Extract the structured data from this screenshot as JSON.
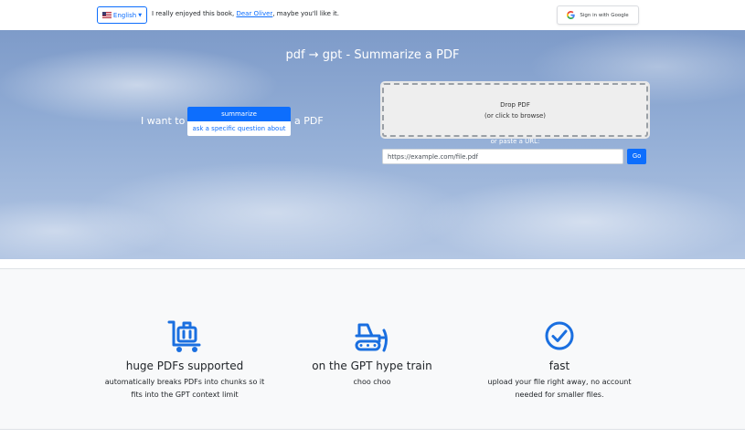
{
  "topbar": {
    "language": "English",
    "tagline_before": "I really enjoyed this book, ",
    "tagline_link": "Dear Oliver",
    "tagline_after": ", maybe you'll like it.",
    "google_signin": "Sign in with Google"
  },
  "hero": {
    "title": "pdf → gpt - Summarize a PDF",
    "i_want_to": "I want to",
    "a_pdf": "a PDF",
    "choices": [
      "summarize",
      "ask a specific question about"
    ],
    "dropzone_title": "Drop PDF",
    "dropzone_subtitle": "(or click to browse)",
    "paste_label": "or paste a URL:",
    "url_placeholder": "https://example.com/file.pdf",
    "go_label": "Go"
  },
  "features": [
    {
      "icon": "luggage-cart-icon",
      "title": "huge PDFs supported",
      "text": "automatically breaks PDFs into chunks so it fits into the GPT context limit"
    },
    {
      "icon": "snowplow-icon",
      "title": "on the GPT hype train",
      "text": "choo choo"
    },
    {
      "icon": "check-circle-icon",
      "title": "fast",
      "text": "upload your file right away, no account needed for smaller files."
    }
  ],
  "colors": {
    "primary": "#0d6efd",
    "feature_icon": "#1a6fe0",
    "hero_sky": "#93aed6"
  }
}
